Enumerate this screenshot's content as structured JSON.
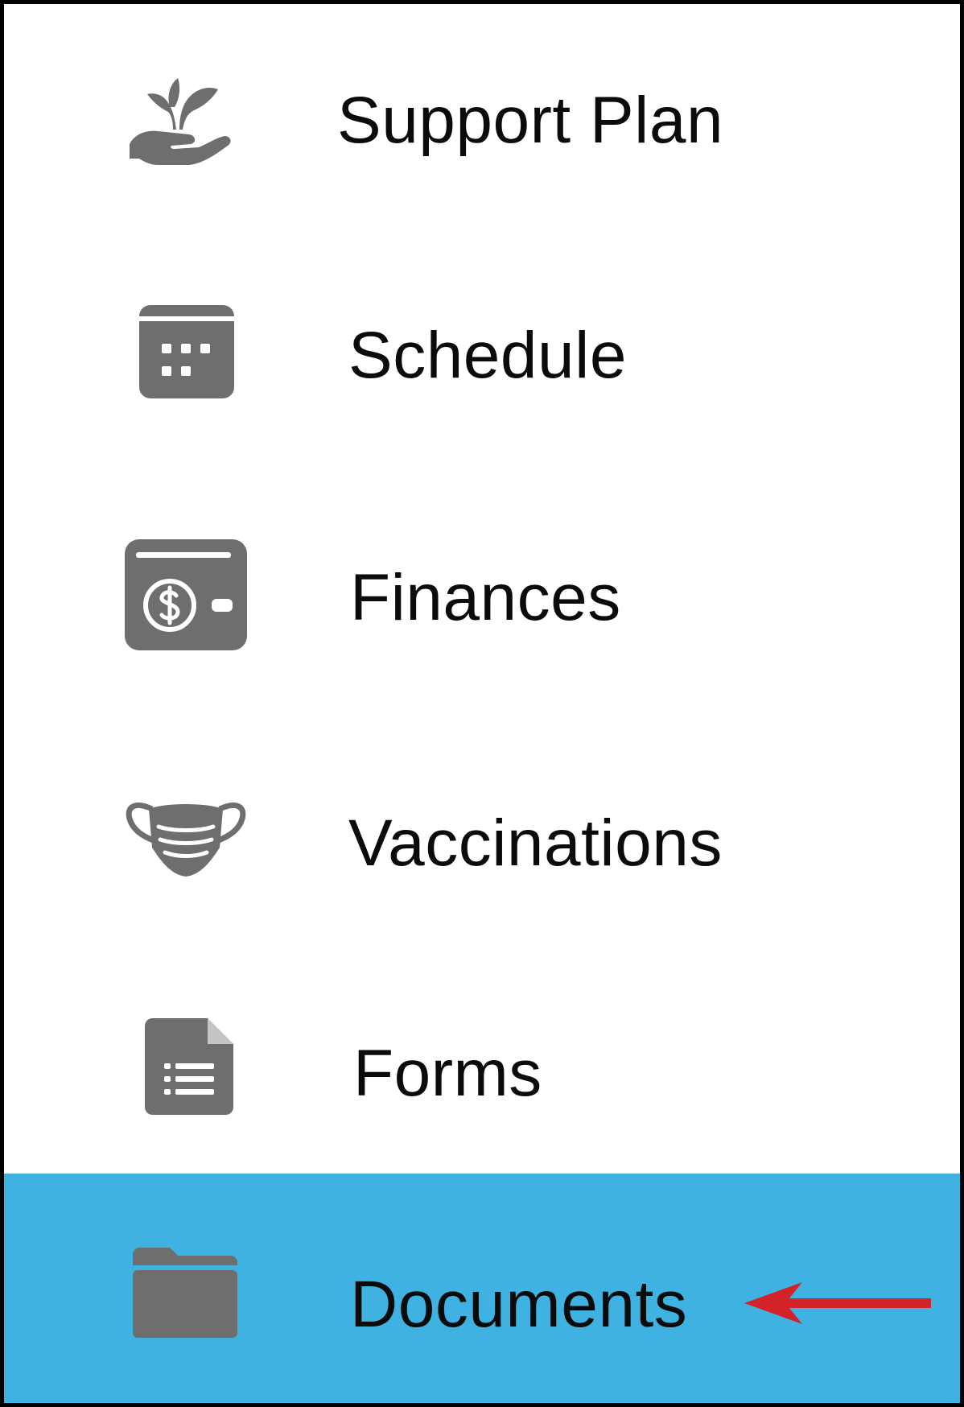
{
  "nav": {
    "items": [
      {
        "id": "support-plan",
        "label": "Support Plan",
        "icon": "hand-plant-icon"
      },
      {
        "id": "schedule",
        "label": "Schedule",
        "icon": "calendar-icon"
      },
      {
        "id": "finances",
        "label": "Finances",
        "icon": "wallet-icon"
      },
      {
        "id": "vaccinations",
        "label": "Vaccinations",
        "icon": "mask-icon"
      },
      {
        "id": "forms",
        "label": "Forms",
        "icon": "form-icon"
      },
      {
        "id": "documents",
        "label": "Documents",
        "icon": "folder-icon",
        "active": true
      }
    ]
  },
  "colors": {
    "active_bg": "#3fb2e2",
    "icon": "#6e6e6e",
    "arrow": "#d2232a",
    "text": "#0b0b0b"
  },
  "annotation": {
    "arrow_target": "Documents"
  }
}
